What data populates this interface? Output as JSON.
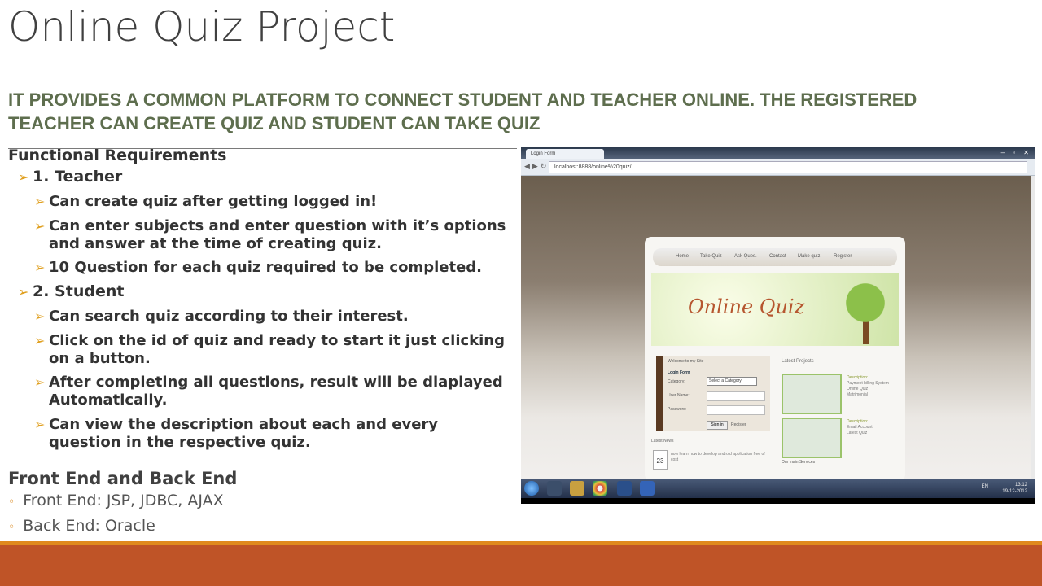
{
  "slide": {
    "title": "Online Quiz Project",
    "subtitle": "IT PROVIDES A COMMON PLATFORM TO CONNECT STUDENT AND TEACHER ONLINE. THE REGISTERED TEACHER CAN CREATE QUIZ AND STUDENT CAN TAKE QUIZ",
    "functional_heading": "Functional Requirements",
    "teacher": {
      "label": "1. Teacher",
      "items": [
        "Can create quiz after getting logged in!",
        "Can enter subjects and enter question with it’s options and answer at the time of creating quiz.",
        "10 Question for each quiz required to be completed."
      ]
    },
    "student": {
      "label": "2. Student",
      "items": [
        "Can search quiz according to their interest.",
        "Click on the id of quiz and ready to start it just clicking on a button.",
        "After completing all questions, result will be diaplayed Automatically.",
        "Can view the description about each and every question in the respective quiz."
      ]
    },
    "frontback_heading": "Front End and Back End",
    "frontend": "Front End: JSP, JDBC, AJAX",
    "backend": "Back End: Oracle",
    "colors": {
      "accent_orange": "#e08a1e",
      "footer": "#bf5427",
      "subtitle_green": "#5e6e4e",
      "arrow": "#e0a020"
    }
  },
  "screenshot": {
    "tab_title": "Login Form",
    "url": "localhost:8888/online%20quiz/",
    "menu": [
      "Home",
      "Take Quiz",
      "Ask Ques.",
      "Contact",
      "Make quiz",
      "Register"
    ],
    "logo": "Online Quiz",
    "welcome": "Welcome to my Site",
    "login_form": "Login Form",
    "category_label": "Category:",
    "category_value": "Select a Category",
    "username_label": "User Name:",
    "password_label": "Password:",
    "signin": "Sign in",
    "register": "Register",
    "latest_projects": "Latest Projects",
    "desc1": [
      "Description:",
      "Payment billing System",
      "Online Quiz",
      "Matrimonial"
    ],
    "desc2": [
      "Description:",
      "Email Account",
      "Latest Quiz"
    ],
    "latest_news": "Latest News",
    "news_day": "23",
    "news_text": "now learn how to develop android application free of cost",
    "our_services": "Our main Services",
    "tray_lang": "EN",
    "tray_time": "13:12",
    "tray_date": "19-12-2012"
  }
}
